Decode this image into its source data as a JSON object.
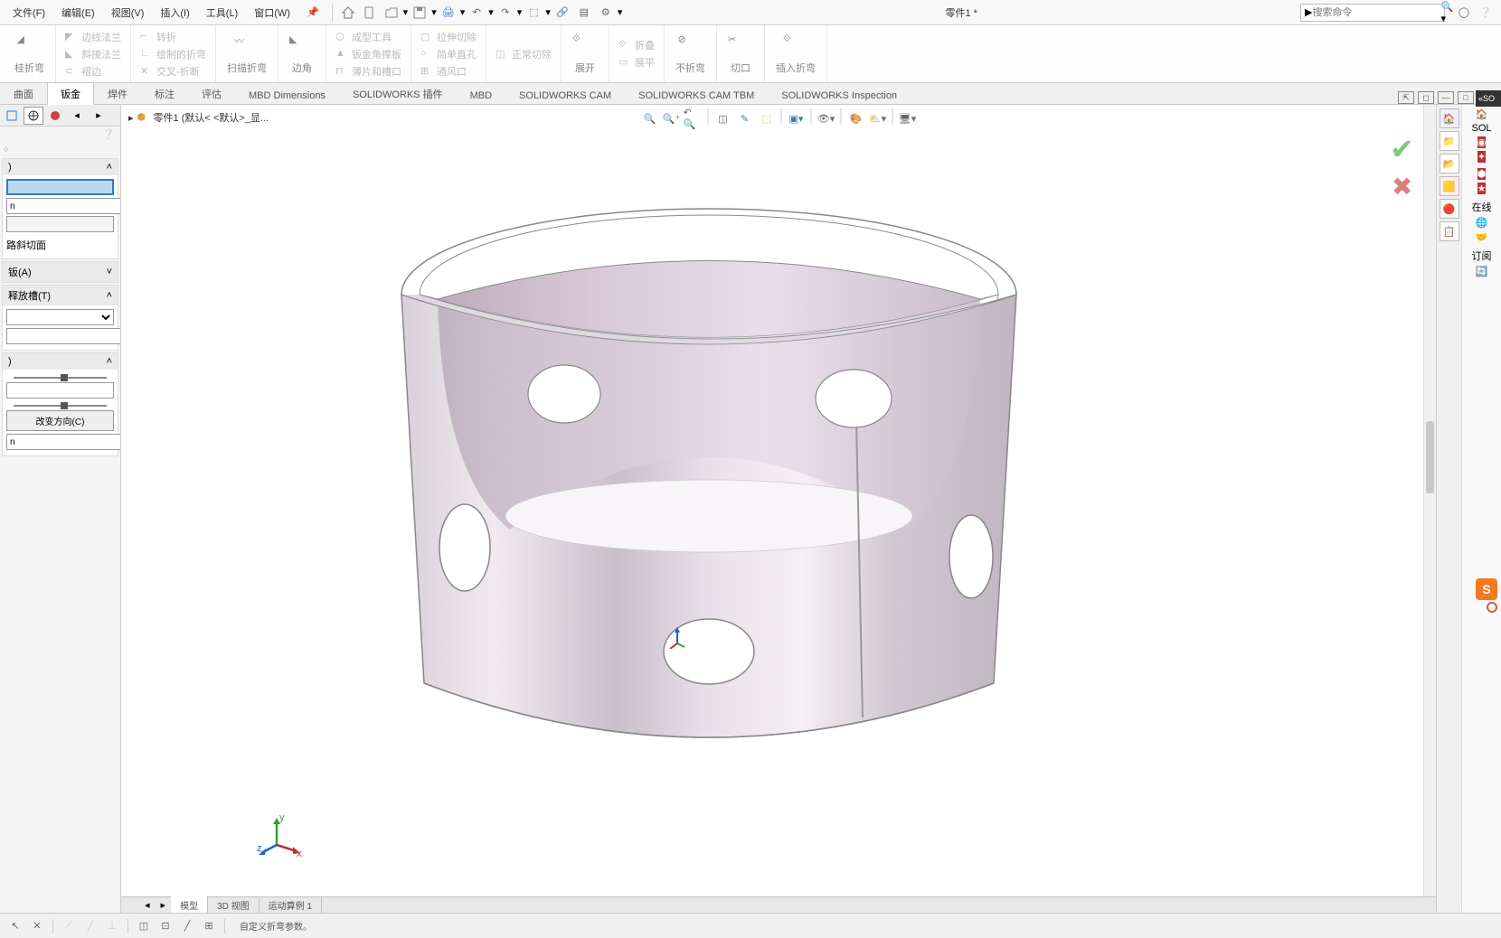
{
  "menus": {
    "file": "文件(F)",
    "edit": "编辑(E)",
    "view": "视图(V)",
    "insert": "插入(I)",
    "tools": "工具(L)",
    "window": "窗口(W)"
  },
  "doc_title": "零件1 *",
  "search_placeholder": "搜索命令",
  "ribbon": {
    "r1a": "边线法兰",
    "r1b": "斜接法兰",
    "r1c": "褶边",
    "r2a": "转折",
    "r2b": "绘制的折弯",
    "r2c": "交叉-折断",
    "r3": "扫描折弯",
    "r4": "边角",
    "r5a": "成型工具",
    "r5b": "钣金角撑板",
    "r5c": "薄片和槽口",
    "r6a": "拉伸切除",
    "r6b": "简单直孔",
    "r6c": "通风口",
    "r7a": "正常切除",
    "r8": "展开",
    "r9a": "折叠",
    "r9b": "展平",
    "r10": "不折弯",
    "r11": "切口",
    "r12": "插入折弯"
  },
  "cm_tabs": [
    "曲面",
    "钣金",
    "焊件",
    "标注",
    "评估",
    "MBD Dimensions",
    "SOLIDWORKS 插件",
    "MBD",
    "SOLIDWORKS CAM",
    "SOLIDWORKS CAM TBM",
    "SOLIDWORKS Inspection"
  ],
  "cm_active": 1,
  "breadcrumb": "零件1  (默认< <默认>_显...",
  "prop": {
    "val1": "n",
    "sec_slope": "路斜切面",
    "sec_a": "钣(A)",
    "sec_relief": "释放槽(T)",
    "btn_reverse": "改变方向(C)",
    "val2": "n"
  },
  "view_tabs": [
    "模型",
    "3D 视图",
    "运动算例 1"
  ],
  "status_text": "自定义折弯参数。",
  "taskpane": {
    "sol": "SOL",
    "online": "在线",
    "sub": "订阅"
  },
  "so_label": "«SO"
}
